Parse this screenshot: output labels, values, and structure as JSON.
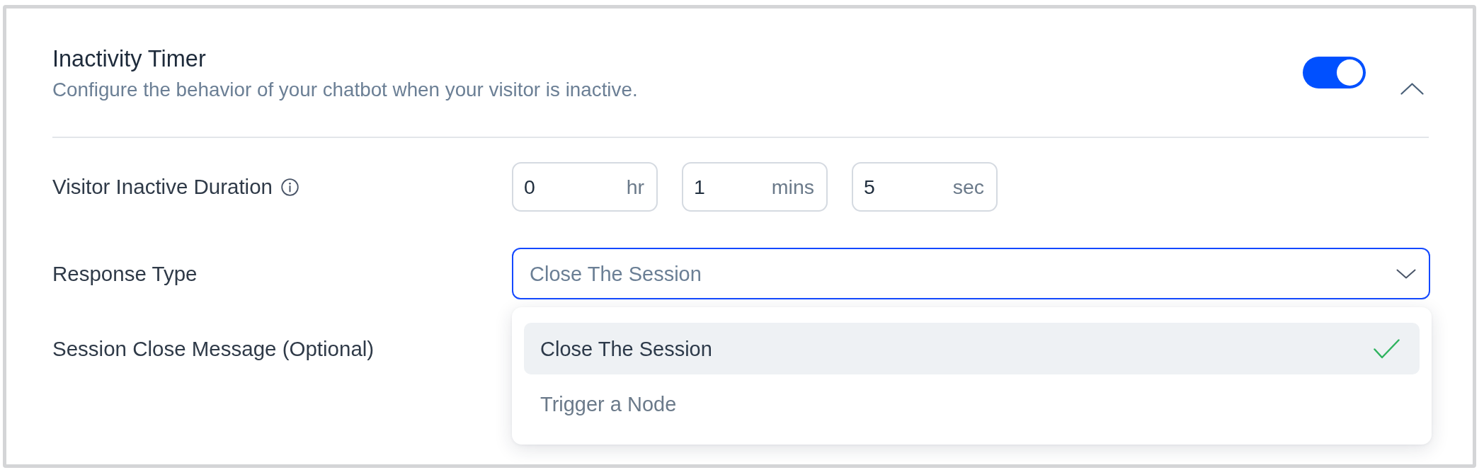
{
  "section": {
    "title": "Inactivity Timer",
    "description": "Configure the behavior of your chatbot when your visitor is inactive.",
    "enabled": true,
    "expanded": true
  },
  "fields": [
    {
      "kind": "duration",
      "label": "Visitor Inactive Duration",
      "info": true,
      "inputs": [
        {
          "value": "0",
          "unit": "hr"
        },
        {
          "value": "1",
          "unit": "mins"
        },
        {
          "value": "5",
          "unit": "sec"
        }
      ]
    },
    {
      "kind": "select",
      "label": "Response Type",
      "info": false,
      "value": "Close The Session",
      "open": true,
      "options": [
        {
          "label": "Close The Session",
          "selected": true
        },
        {
          "label": "Trigger a Node",
          "selected": false
        }
      ]
    },
    {
      "kind": "message",
      "label": "Session Close Message (Optional)",
      "info": false
    }
  ]
}
